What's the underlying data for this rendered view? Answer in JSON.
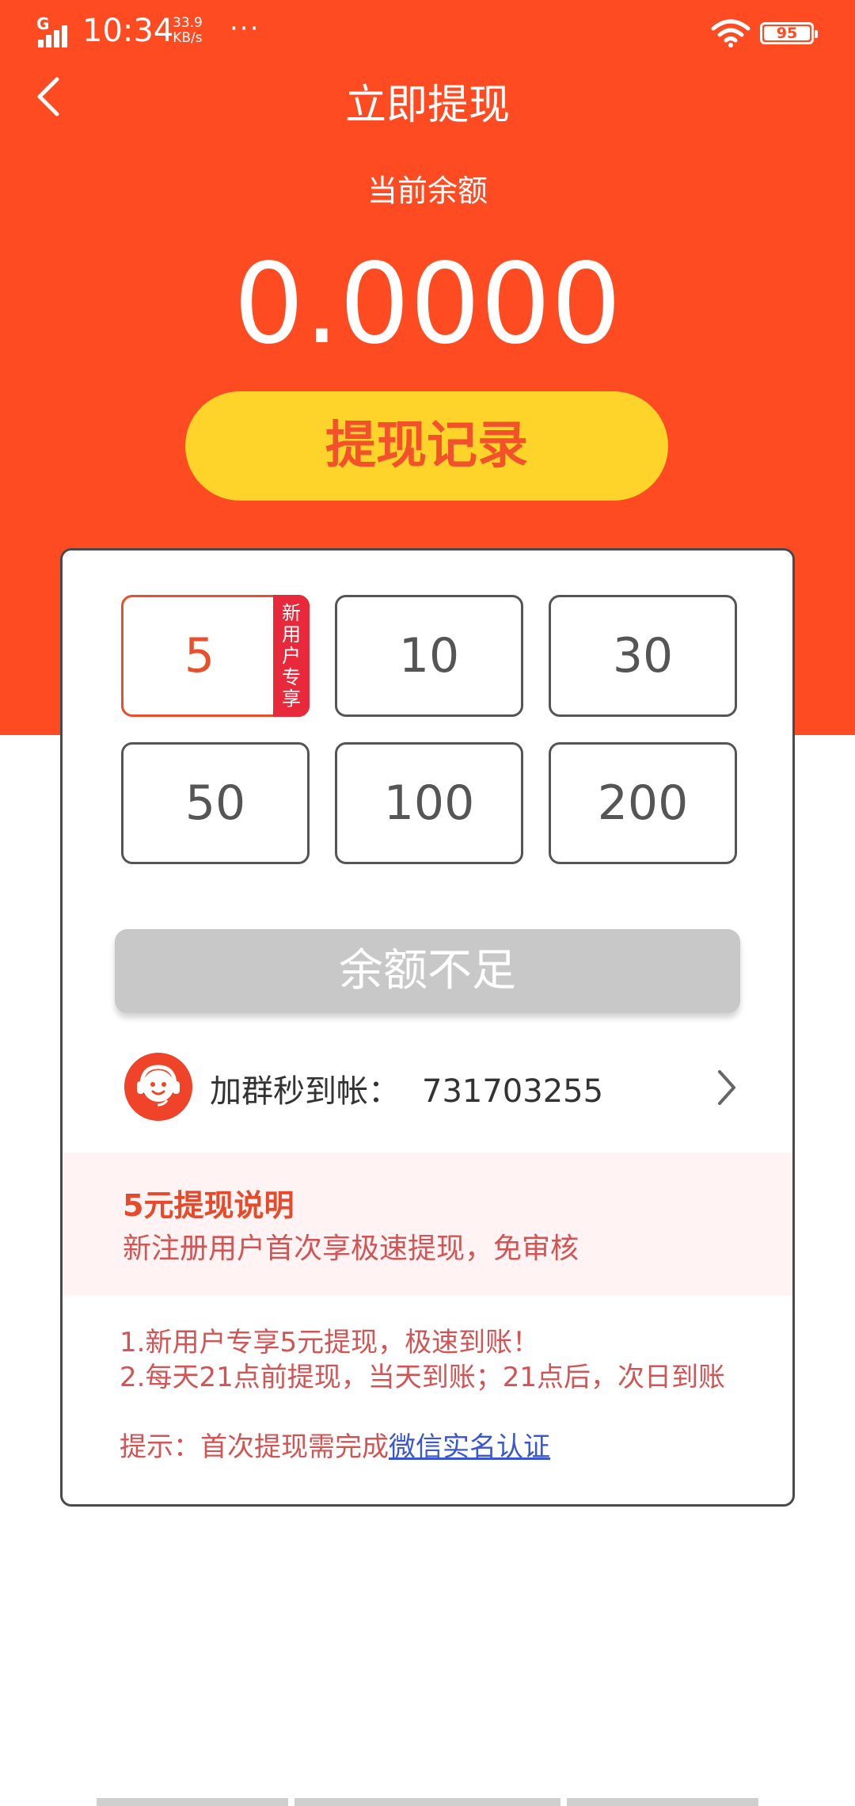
{
  "status_bar": {
    "network": "G",
    "time": "10:34",
    "speed_value": "33.9",
    "speed_unit": "KB/s",
    "more": "···",
    "battery": "95"
  },
  "header": {
    "title": "立即提现"
  },
  "balance": {
    "label": "当前余额",
    "value": "0.0000"
  },
  "record_button": "提现记录",
  "amount_options": [
    {
      "value": "5",
      "tag": [
        "新",
        "用",
        "户",
        "专",
        "享"
      ],
      "selected": true
    },
    {
      "value": "10"
    },
    {
      "value": "30"
    },
    {
      "value": "50"
    },
    {
      "value": "100"
    },
    {
      "value": "200"
    }
  ],
  "insufficient_button": "余额不足",
  "qq_group": {
    "label": "加群秒到帐：",
    "number": "731703255"
  },
  "info": {
    "title": "5元提现说明",
    "subtitle": "新注册用户首次享极速提现，免审核"
  },
  "rules": {
    "line1": "1.新用户专享5元提现，极速到账！",
    "line2": "2.每天21点前提现，当天到账；21点后，次日到账",
    "tip_prefix": "提示：首次提现需完成",
    "tip_link": "微信实名认证"
  },
  "colors": {
    "brand": "#ff4b22",
    "button_yellow": "#ffd42a",
    "tag_red": "#e8293b",
    "disabled_gray": "#c8c8c8",
    "link_blue": "#3a56d4"
  }
}
